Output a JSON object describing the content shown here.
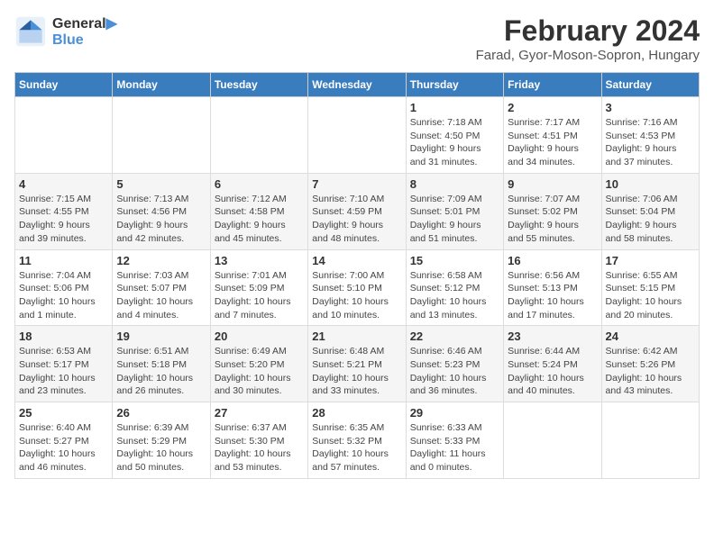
{
  "header": {
    "logo_line1": "General",
    "logo_line2": "Blue",
    "main_title": "February 2024",
    "subtitle": "Farad, Gyor-Moson-Sopron, Hungary"
  },
  "calendar": {
    "days_of_week": [
      "Sunday",
      "Monday",
      "Tuesday",
      "Wednesday",
      "Thursday",
      "Friday",
      "Saturday"
    ],
    "rows": [
      [
        {
          "day": "",
          "detail": ""
        },
        {
          "day": "",
          "detail": ""
        },
        {
          "day": "",
          "detail": ""
        },
        {
          "day": "",
          "detail": ""
        },
        {
          "day": "1",
          "detail": "Sunrise: 7:18 AM\nSunset: 4:50 PM\nDaylight: 9 hours\nand 31 minutes."
        },
        {
          "day": "2",
          "detail": "Sunrise: 7:17 AM\nSunset: 4:51 PM\nDaylight: 9 hours\nand 34 minutes."
        },
        {
          "day": "3",
          "detail": "Sunrise: 7:16 AM\nSunset: 4:53 PM\nDaylight: 9 hours\nand 37 minutes."
        }
      ],
      [
        {
          "day": "4",
          "detail": "Sunrise: 7:15 AM\nSunset: 4:55 PM\nDaylight: 9 hours\nand 39 minutes."
        },
        {
          "day": "5",
          "detail": "Sunrise: 7:13 AM\nSunset: 4:56 PM\nDaylight: 9 hours\nand 42 minutes."
        },
        {
          "day": "6",
          "detail": "Sunrise: 7:12 AM\nSunset: 4:58 PM\nDaylight: 9 hours\nand 45 minutes."
        },
        {
          "day": "7",
          "detail": "Sunrise: 7:10 AM\nSunset: 4:59 PM\nDaylight: 9 hours\nand 48 minutes."
        },
        {
          "day": "8",
          "detail": "Sunrise: 7:09 AM\nSunset: 5:01 PM\nDaylight: 9 hours\nand 51 minutes."
        },
        {
          "day": "9",
          "detail": "Sunrise: 7:07 AM\nSunset: 5:02 PM\nDaylight: 9 hours\nand 55 minutes."
        },
        {
          "day": "10",
          "detail": "Sunrise: 7:06 AM\nSunset: 5:04 PM\nDaylight: 9 hours\nand 58 minutes."
        }
      ],
      [
        {
          "day": "11",
          "detail": "Sunrise: 7:04 AM\nSunset: 5:06 PM\nDaylight: 10 hours\nand 1 minute."
        },
        {
          "day": "12",
          "detail": "Sunrise: 7:03 AM\nSunset: 5:07 PM\nDaylight: 10 hours\nand 4 minutes."
        },
        {
          "day": "13",
          "detail": "Sunrise: 7:01 AM\nSunset: 5:09 PM\nDaylight: 10 hours\nand 7 minutes."
        },
        {
          "day": "14",
          "detail": "Sunrise: 7:00 AM\nSunset: 5:10 PM\nDaylight: 10 hours\nand 10 minutes."
        },
        {
          "day": "15",
          "detail": "Sunrise: 6:58 AM\nSunset: 5:12 PM\nDaylight: 10 hours\nand 13 minutes."
        },
        {
          "day": "16",
          "detail": "Sunrise: 6:56 AM\nSunset: 5:13 PM\nDaylight: 10 hours\nand 17 minutes."
        },
        {
          "day": "17",
          "detail": "Sunrise: 6:55 AM\nSunset: 5:15 PM\nDaylight: 10 hours\nand 20 minutes."
        }
      ],
      [
        {
          "day": "18",
          "detail": "Sunrise: 6:53 AM\nSunset: 5:17 PM\nDaylight: 10 hours\nand 23 minutes."
        },
        {
          "day": "19",
          "detail": "Sunrise: 6:51 AM\nSunset: 5:18 PM\nDaylight: 10 hours\nand 26 minutes."
        },
        {
          "day": "20",
          "detail": "Sunrise: 6:49 AM\nSunset: 5:20 PM\nDaylight: 10 hours\nand 30 minutes."
        },
        {
          "day": "21",
          "detail": "Sunrise: 6:48 AM\nSunset: 5:21 PM\nDaylight: 10 hours\nand 33 minutes."
        },
        {
          "day": "22",
          "detail": "Sunrise: 6:46 AM\nSunset: 5:23 PM\nDaylight: 10 hours\nand 36 minutes."
        },
        {
          "day": "23",
          "detail": "Sunrise: 6:44 AM\nSunset: 5:24 PM\nDaylight: 10 hours\nand 40 minutes."
        },
        {
          "day": "24",
          "detail": "Sunrise: 6:42 AM\nSunset: 5:26 PM\nDaylight: 10 hours\nand 43 minutes."
        }
      ],
      [
        {
          "day": "25",
          "detail": "Sunrise: 6:40 AM\nSunset: 5:27 PM\nDaylight: 10 hours\nand 46 minutes."
        },
        {
          "day": "26",
          "detail": "Sunrise: 6:39 AM\nSunset: 5:29 PM\nDaylight: 10 hours\nand 50 minutes."
        },
        {
          "day": "27",
          "detail": "Sunrise: 6:37 AM\nSunset: 5:30 PM\nDaylight: 10 hours\nand 53 minutes."
        },
        {
          "day": "28",
          "detail": "Sunrise: 6:35 AM\nSunset: 5:32 PM\nDaylight: 10 hours\nand 57 minutes."
        },
        {
          "day": "29",
          "detail": "Sunrise: 6:33 AM\nSunset: 5:33 PM\nDaylight: 11 hours\nand 0 minutes."
        },
        {
          "day": "",
          "detail": ""
        },
        {
          "day": "",
          "detail": ""
        }
      ]
    ]
  }
}
